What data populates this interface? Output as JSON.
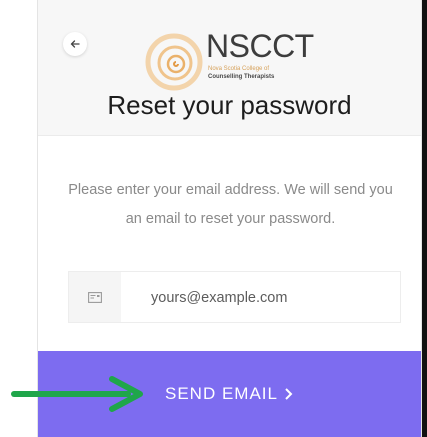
{
  "header": {
    "back_icon": "arrow-left-icon",
    "logo": {
      "name": "NSCCT",
      "line1": "Nova Scotia College of",
      "line2": "Counselling Therapists",
      "colors": {
        "ring": "#f0c896",
        "text": "#3d3d3d"
      }
    },
    "title": "Reset your password"
  },
  "form": {
    "instructions": "Please enter your email address. We will send you an email to reset your password.",
    "email_placeholder": "yours@example.com",
    "email_icon": "envelope-icon",
    "submit_label": "SEND EMAIL",
    "submit_icon": "chevron-right-icon"
  },
  "annotation": {
    "pointer_icon": "arrow-right-icon",
    "color": "#1fa64a"
  },
  "colors": {
    "accent": "#7d6cf0",
    "header_bg": "#f7f7f7"
  }
}
